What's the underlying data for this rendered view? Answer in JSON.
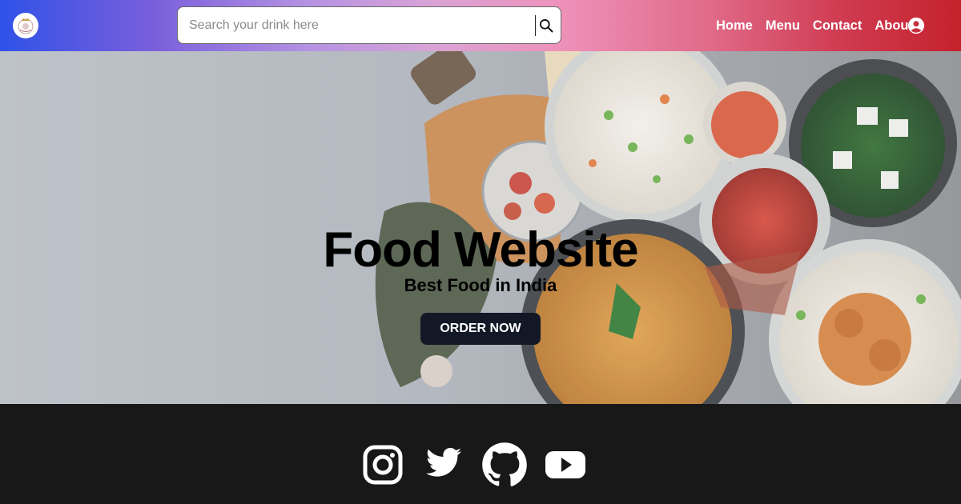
{
  "navbar": {
    "logo_icon": "royal-crest-logo",
    "search": {
      "placeholder": "Search your drink here",
      "value": "",
      "icon": "search-icon"
    },
    "links": [
      "Home",
      "Menu",
      "Contact",
      "About"
    ],
    "user_icon": "user-circle-icon"
  },
  "hero": {
    "title": "Food Website",
    "subtitle": "Best Food in India",
    "button_label": "ORDER NOW"
  },
  "footer": {
    "social": [
      "instagram-icon",
      "twitter-icon",
      "github-icon",
      "youtube-icon"
    ]
  },
  "colors": {
    "nav_gradient_start": "#2f52e8",
    "nav_gradient_end": "#c4222c",
    "button_bg": "#121826",
    "footer_bg": "#181818"
  }
}
